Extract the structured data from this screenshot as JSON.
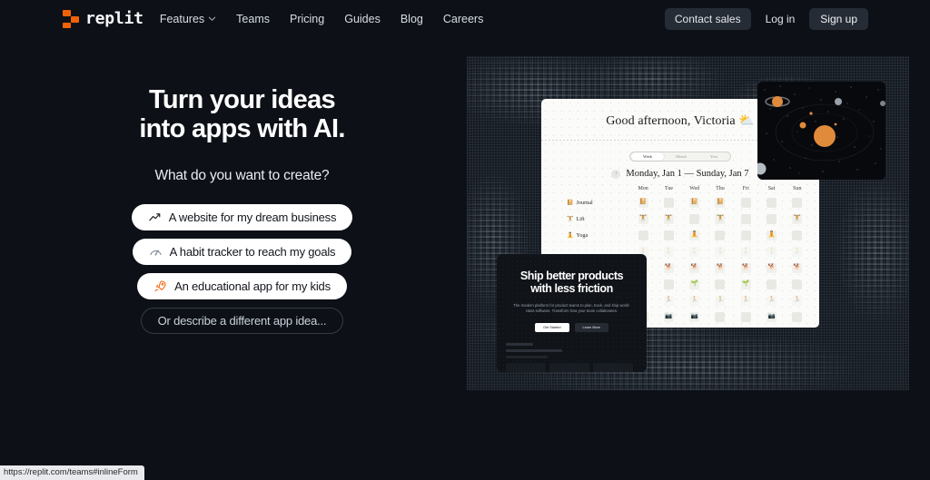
{
  "brand": {
    "name": "replit",
    "accent": "#f26207",
    "background": "#0d1117"
  },
  "header": {
    "nav": [
      {
        "label": "Features",
        "has_dropdown": true,
        "icon": "chevron-down-icon"
      },
      {
        "label": "Teams",
        "has_dropdown": false
      },
      {
        "label": "Pricing",
        "has_dropdown": false
      },
      {
        "label": "Guides",
        "has_dropdown": false
      },
      {
        "label": "Blog",
        "has_dropdown": false
      },
      {
        "label": "Careers",
        "has_dropdown": false
      }
    ],
    "contact_sales_label": "Contact sales",
    "login_label": "Log in",
    "signup_label": "Sign up"
  },
  "hero": {
    "headline_line1": "Turn your ideas",
    "headline_line2": "into apps with AI.",
    "subheadline": "What do you want to create?",
    "suggestions": [
      {
        "label": "A website for my dream business",
        "icon": "trending-up-icon",
        "style": "light"
      },
      {
        "label": "A habit tracker to reach my goals",
        "icon": "gauge-icon",
        "style": "light"
      },
      {
        "label": "An educational app for my kids",
        "icon": "rocket-icon",
        "style": "light"
      },
      {
        "label": "Or describe a different app idea...",
        "icon": "none",
        "style": "ghost"
      }
    ]
  },
  "showcase": {
    "habit_app": {
      "greeting": "Good afternoon, Victoria",
      "greeting_emoji": "⛅",
      "range_selector": {
        "options": [
          "Week",
          "Month",
          "Year"
        ],
        "selected": "Week"
      },
      "date_range": "Monday, Jan 1 — Sunday, Jan 7",
      "prev_label": "‹",
      "day_headers": [
        "Mon",
        "Tue",
        "Wed",
        "Thu",
        "Fri",
        "Sat",
        "Sun"
      ],
      "habits": [
        {
          "name": "Journal",
          "emoji": "📔",
          "checked": [
            true,
            false,
            true,
            true,
            false,
            false,
            false
          ],
          "faded": false
        },
        {
          "name": "Lift",
          "emoji": "🏋️",
          "checked": [
            true,
            true,
            false,
            true,
            false,
            false,
            true
          ],
          "faded": false
        },
        {
          "name": "Yoga",
          "emoji": "🧘",
          "checked": [
            false,
            false,
            true,
            false,
            false,
            true,
            false
          ],
          "faded": false
        },
        {
          "name": "",
          "emoji": "🕯️",
          "checked": [
            true,
            true,
            true,
            true,
            true,
            true,
            true
          ],
          "faded": true
        },
        {
          "name": "",
          "emoji": "🐕",
          "checked": [
            true,
            true,
            true,
            true,
            true,
            true,
            true
          ],
          "faded": false
        },
        {
          "name": "",
          "emoji": "🌱",
          "checked": [
            true,
            false,
            true,
            false,
            true,
            false,
            false
          ],
          "faded": false
        },
        {
          "name": "",
          "emoji": "🏃",
          "checked": [
            true,
            true,
            true,
            true,
            true,
            true,
            true
          ],
          "faded": true
        },
        {
          "name": "",
          "emoji": "📷",
          "checked": [
            false,
            true,
            true,
            false,
            false,
            true,
            false
          ],
          "faded": false
        }
      ]
    },
    "space_app": {
      "title": "solar-system-scene",
      "sun_color": "#e08a3c",
      "background": "#08090c"
    },
    "product_app": {
      "title_line1": "Ship better products",
      "title_line2": "with less friction",
      "subtitle": "The modern platform for product teams to plan, track, and ship world-class software. Transform how your team collaborates.",
      "primary_button": "Get Started",
      "secondary_button": "Learn More"
    }
  },
  "statusbar": {
    "url": "https://replit.com/teams#inlineForm"
  }
}
